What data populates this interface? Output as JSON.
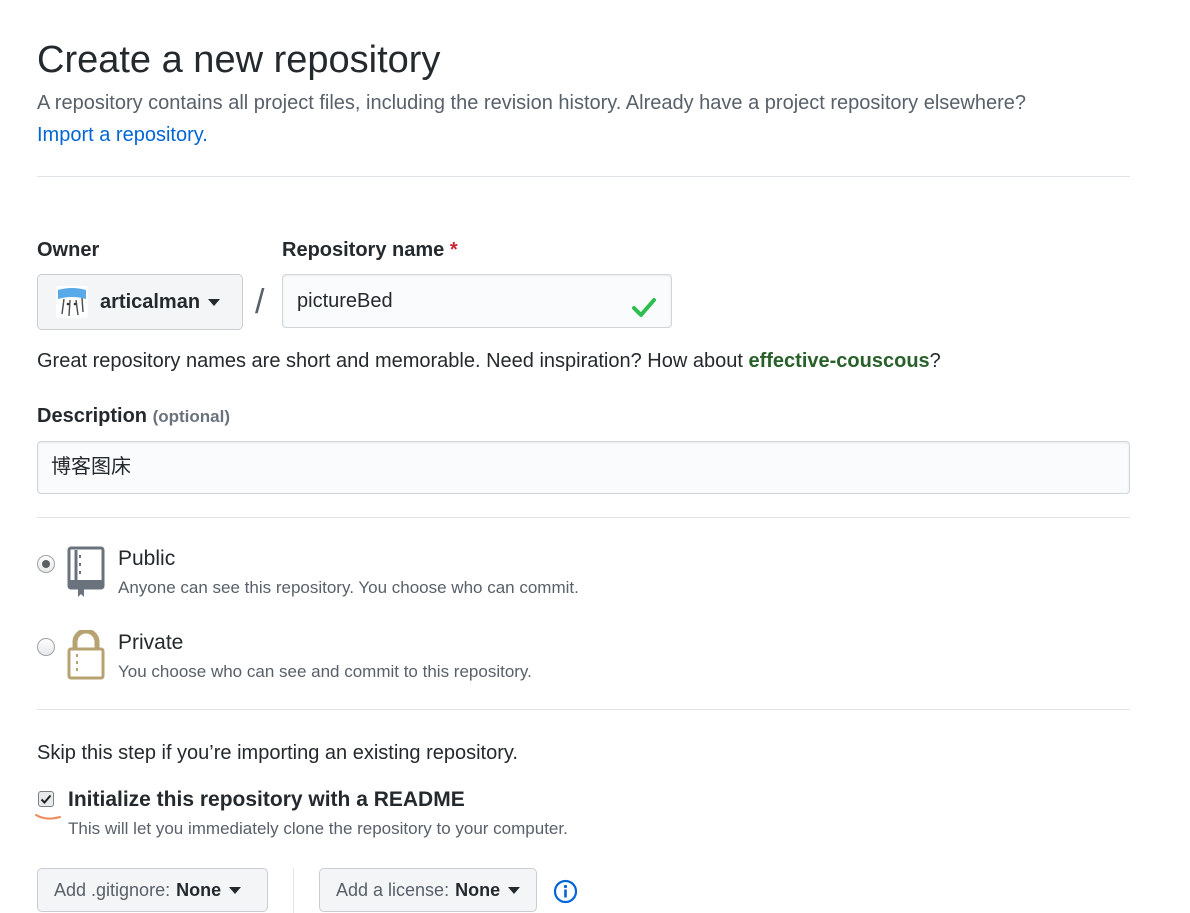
{
  "header": {
    "title": "Create a new repository",
    "subtitle": "A repository contains all project files, including the revision history. Already have a project repository elsewhere?",
    "import_link": "Import a repository."
  },
  "owner": {
    "label": "Owner",
    "value": "articalman"
  },
  "repo_name": {
    "label": "Repository name",
    "required_mark": "*",
    "value": "pictureBed",
    "separator": "/"
  },
  "name_hint": {
    "prefix": "Great repository names are short and memorable. Need inspiration? How about ",
    "suggestion": "effective-couscous",
    "suffix": "?"
  },
  "description": {
    "label": "Description",
    "optional": "(optional)",
    "value": "博客图床"
  },
  "visibility": {
    "selected": "public",
    "public": {
      "title": "Public",
      "desc": "Anyone can see this repository. You choose who can commit."
    },
    "private": {
      "title": "Private",
      "desc": "You choose who can see and commit to this repository."
    }
  },
  "init": {
    "skip_text": "Skip this step if you’re importing an existing repository.",
    "readme_label": "Initialize this repository with a README",
    "readme_desc": "This will let you immediately clone the repository to your computer.",
    "readme_checked": true
  },
  "gitignore": {
    "label": "Add .gitignore:",
    "value": "None"
  },
  "license": {
    "label": "Add a license:",
    "value": "None"
  },
  "colors": {
    "link": "#0366d6",
    "success_check": "#2cbe4e",
    "suggestion": "#28602a",
    "required": "#cb2431",
    "lock_icon": "#b7a272",
    "annotation_mark": "#f08a5d"
  },
  "icons": [
    "check-icon",
    "avatar",
    "repo-book-icon",
    "lock-icon",
    "info-icon",
    "caret-down-icon",
    "checkmark-icon"
  ]
}
